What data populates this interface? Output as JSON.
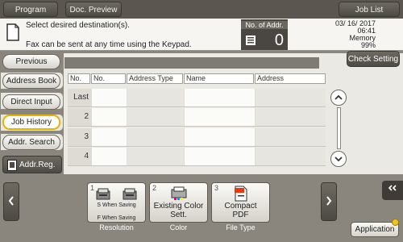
{
  "top_tabs": {
    "program": "Program",
    "doc_preview": "Doc. Preview",
    "job_list": "Job List"
  },
  "message": {
    "line1": "Select desired destination(s).",
    "line2": "Fax can be sent at any time using the Keypad."
  },
  "addr_counter": {
    "label": "No. of Addr.",
    "value": "0"
  },
  "status": {
    "date": "03/ 16/ 2017",
    "time": "06:41",
    "memory_label": "Memory",
    "memory_value": "99%"
  },
  "sidebar": {
    "previous": "Previous",
    "address_book": "Address Book",
    "direct_input": "Direct Input",
    "job_history": "Job History",
    "addr_search": "Addr. Search",
    "addr_reg": "Addr.Reg."
  },
  "check_setting": "Check Setting",
  "table": {
    "headers": [
      "No.",
      "No.",
      "Address Type",
      "Name",
      "Address"
    ],
    "rows": [
      "Last",
      "2",
      "3",
      "4"
    ]
  },
  "functions": [
    {
      "num": "1",
      "text1": "S When Saving",
      "text2": "F When Saving",
      "label": "Resolution"
    },
    {
      "num": "2",
      "text": "Existing Color Sett.",
      "label": "Color"
    },
    {
      "num": "3",
      "text": "Compact PDF",
      "label": "File Type"
    }
  ],
  "application": "Application",
  "colors": {
    "accent_active": "#e0b400",
    "dark_button": "#4d4a44",
    "background": "#8a867d"
  }
}
